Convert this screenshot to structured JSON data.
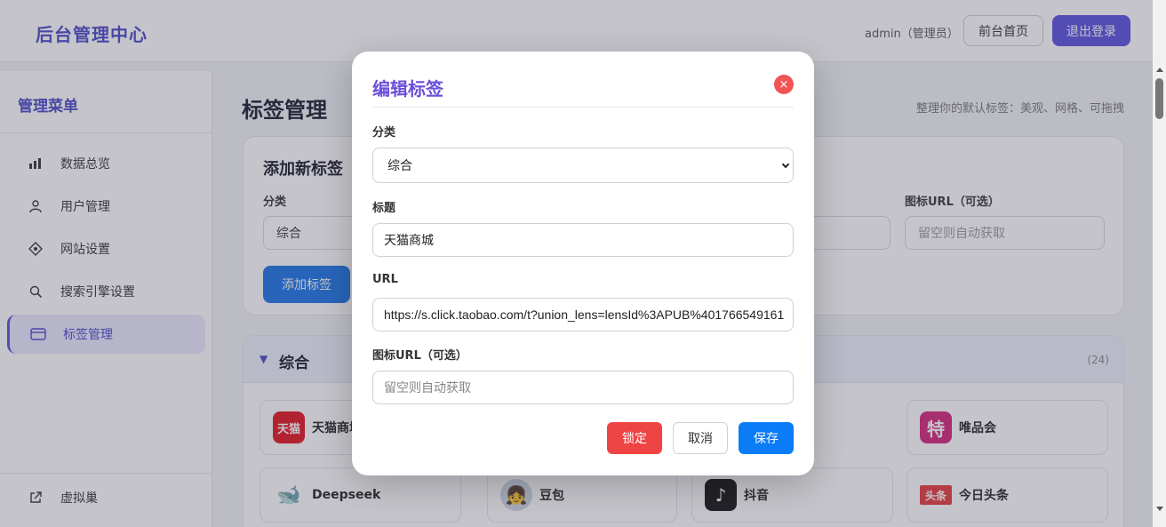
{
  "header": {
    "brand": "后台管理中心",
    "user_label": "admin（管理员）",
    "home_button": "前台首页",
    "logout_button": "退出登录"
  },
  "sidebar": {
    "title": "管理菜单",
    "items": [
      {
        "label": "数据总览",
        "icon": "bar-chart-icon"
      },
      {
        "label": "用户管理",
        "icon": "user-icon"
      },
      {
        "label": "网站设置",
        "icon": "settings-icon"
      },
      {
        "label": "搜索引擎设置",
        "icon": "search-icon"
      },
      {
        "label": "标签管理",
        "icon": "card-icon",
        "active": true
      }
    ],
    "bottom_item": {
      "label": "虚拟巢",
      "icon": "external-link-icon"
    }
  },
  "main": {
    "title": "标签管理",
    "hint": "整理你的默认标签：美观、网格、可拖拽",
    "add_card": {
      "title": "添加新标签",
      "category_label": "分类",
      "category_value": "综合",
      "icon_url_label": "图标URL（可选）",
      "icon_url_placeholder": "留空则自动获取",
      "add_button": "添加标签"
    },
    "list": {
      "title": "综合",
      "count": "(24)",
      "tiles": [
        {
          "name": "天猫商城",
          "logo": "天猫",
          "color": "#e4131e"
        },
        {
          "name": "唯品会",
          "logo": "特",
          "color": "#d4237a"
        },
        {
          "name": "Deepseek",
          "logo": "🐋",
          "color": "#ffffff"
        },
        {
          "name": "豆包",
          "logo": "👧",
          "color": "#cfd8e6"
        },
        {
          "name": "抖音",
          "logo": "♪",
          "color": "#111111"
        },
        {
          "name": "今日头条",
          "logo": "头条",
          "color": "#e8393a"
        }
      ]
    }
  },
  "modal": {
    "title": "编辑标签",
    "close_symbol": "×",
    "category_label": "分类",
    "category_value": "综合",
    "title_label": "标题",
    "title_value": "天猫商城",
    "url_label": "URL",
    "url_value": "https://s.click.taobao.com/t?union_lens=lensId%3APUB%401766549161",
    "icon_url_label": "图标URL（可选）",
    "icon_url_placeholder": "留空则自动获取",
    "lock_button": "锁定",
    "cancel_button": "取消",
    "save_button": "保存"
  }
}
